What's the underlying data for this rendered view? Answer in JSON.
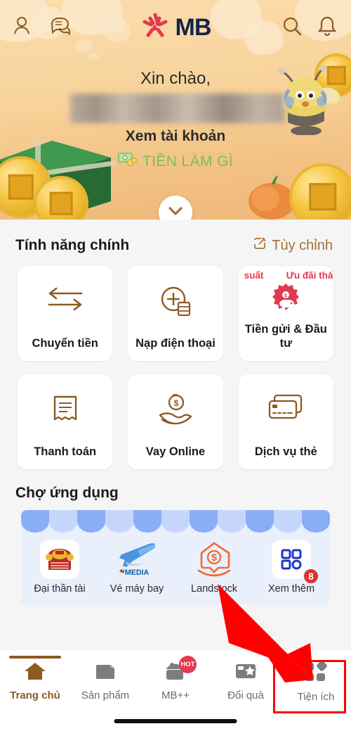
{
  "header": {
    "brand": "MB",
    "icons": {
      "profile": "person-icon",
      "chat": "chat-icon",
      "search": "search-icon",
      "bell": "bell-icon",
      "logo": "mb-star-logo-icon"
    }
  },
  "banner": {
    "greeting": "Xin chào,",
    "user_name_masked": "",
    "view_account": "Xem tài khoản",
    "promo_label": "TIỀN LÀM GÌ",
    "promo_color": "#7dbf5a",
    "expand_icon": "chevron-down-icon",
    "mascot": "bee-mascot-icon"
  },
  "features": {
    "title": "Tính năng chính",
    "customize_label": "Tùy chỉnh",
    "customize_icon": "edit-pencil-icon",
    "customize_color": "#a3703a",
    "items": [
      {
        "label": "Chuyển tiền",
        "icon": "transfer-arrows-icon"
      },
      {
        "label": "Nạp điện thoại",
        "icon": "topup-plus-icon"
      },
      {
        "label": "Tiền gửi & Đầu tư",
        "icon": "piggy-bank-badge-icon",
        "marquee": [
          "suất",
          "Ưu đãi thán"
        ],
        "marquee_color": "#e8384f"
      },
      {
        "label": "Thanh toán",
        "icon": "receipt-icon"
      },
      {
        "label": "Vay Online",
        "icon": "hand-coin-icon"
      },
      {
        "label": "Dịch vụ thẻ",
        "icon": "cards-icon"
      }
    ]
  },
  "market": {
    "title": "Chợ ứng dụng",
    "apps": [
      {
        "label": "Đại thần tài",
        "icon": "dai-than-tai-icon"
      },
      {
        "label": "Vé máy bay",
        "icon": "airplane-smedia-icon"
      },
      {
        "label": "Landstock",
        "icon": "landstock-house-icon"
      },
      {
        "label": "Xem thêm",
        "icon": "grid-more-icon",
        "badge": "8"
      }
    ]
  },
  "bottom_nav": {
    "items": [
      {
        "label": "Trang chủ",
        "icon": "home-icon",
        "active": true
      },
      {
        "label": "Sản phẩm",
        "icon": "folder-icon",
        "active": false
      },
      {
        "label": "MB++",
        "icon": "gift-box-icon",
        "badge": "HOT",
        "active": false
      },
      {
        "label": "Đổi quà",
        "icon": "card-star-icon",
        "active": false
      },
      {
        "label": "Tiện ích",
        "icon": "utilities-grid-icon",
        "active": false,
        "highlighted": true
      }
    ],
    "active_color": "#8d5a24",
    "inactive_color": "#6c6c6c"
  },
  "annotations": {
    "highlight_color": "#ff0000",
    "arrow": "red-pointer-arrow",
    "target": "Tiện ích"
  }
}
